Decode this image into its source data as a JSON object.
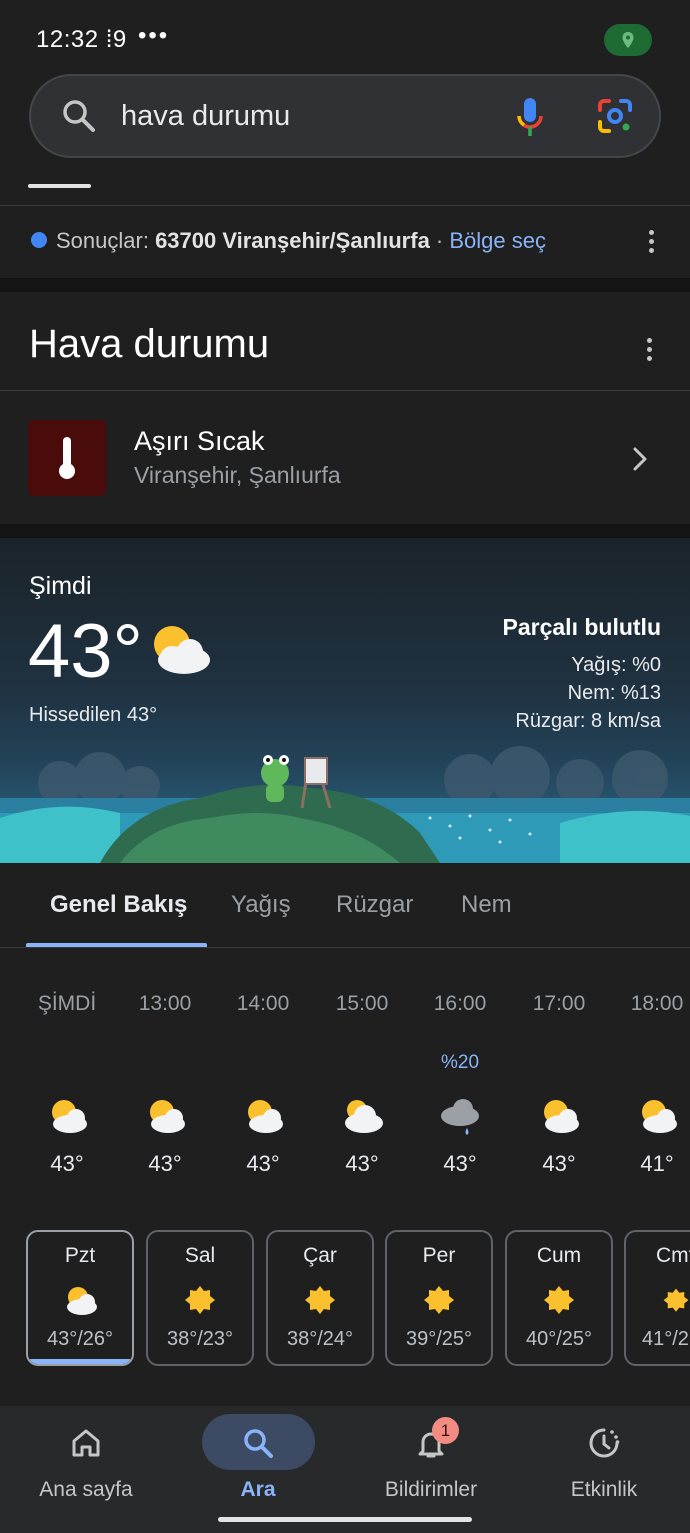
{
  "status_bar": {
    "time": "12:32",
    "extra": "⁞9",
    "dots": "•••"
  },
  "search": {
    "query": "hava durumu"
  },
  "results": {
    "prefix": "Sonuçlar: ",
    "location": "63700 Viranşehir/Şanlıurfa",
    "separator": " · ",
    "link": "Bölge seç"
  },
  "card": {
    "title": "Hava durumu"
  },
  "alert": {
    "title": "Aşırı Sıcak",
    "subtitle": "Viranşehir, Şanlıurfa"
  },
  "current": {
    "label": "Şimdi",
    "temp": "43°",
    "feels_like": "Hissedilen 43°",
    "condition": "Parçalı bulutlu",
    "precip": "Yağış: %0",
    "humidity": "Nem: %13",
    "wind": "Rüzgar: 8 km/sa"
  },
  "tabs": [
    "Genel Bakış",
    "Yağış",
    "Rüzgar",
    "Nem"
  ],
  "hourly": [
    {
      "time": "ŞİMDİ",
      "pct": "",
      "icon": "partly-cloudy-icon",
      "temp": "43°"
    },
    {
      "time": "13:00",
      "pct": "",
      "icon": "partly-cloudy-icon",
      "temp": "43°"
    },
    {
      "time": "14:00",
      "pct": "",
      "icon": "partly-cloudy-icon",
      "temp": "43°"
    },
    {
      "time": "15:00",
      "pct": "",
      "icon": "mostly-cloudy-icon",
      "temp": "43°"
    },
    {
      "time": "16:00",
      "pct": "%20",
      "icon": "rain-cloud-icon",
      "temp": "43°"
    },
    {
      "time": "17:00",
      "pct": "",
      "icon": "partly-cloudy-icon",
      "temp": "43°"
    },
    {
      "time": "18:00",
      "pct": "",
      "icon": "partly-cloudy-icon",
      "temp": "41°"
    }
  ],
  "daily": [
    {
      "day": "Pzt",
      "icon": "partly-cloudy-icon",
      "temps": "43°/26°",
      "selected": true
    },
    {
      "day": "Sal",
      "icon": "sun-icon",
      "temps": "38°/23°"
    },
    {
      "day": "Çar",
      "icon": "sun-icon",
      "temps": "38°/24°"
    },
    {
      "day": "Per",
      "icon": "sun-icon",
      "temps": "39°/25°"
    },
    {
      "day": "Cum",
      "icon": "sun-icon",
      "temps": "40°/25°"
    },
    {
      "day": "Cmt",
      "icon": "sun-icon",
      "temps": "41°/2"
    }
  ],
  "nav": {
    "home": "Ana sayfa",
    "search": "Ara",
    "notifications": "Bildirimler",
    "activity": "Etkinlik",
    "badge": "1"
  },
  "colors": {
    "accent": "#8ab4f8",
    "background": "#1f1f1f",
    "alert_bg": "#4a0b0b"
  }
}
